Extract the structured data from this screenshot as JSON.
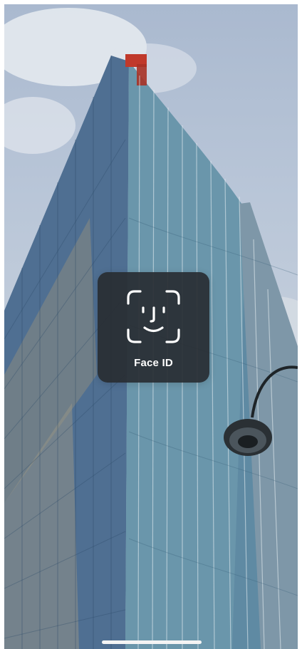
{
  "screen": {
    "type": "lock-screen",
    "wallpaper": "glass-skyscraper-photo"
  },
  "faceid_prompt": {
    "label": "Face ID",
    "icon": "face-id-icon",
    "background_color": "#2c3036",
    "text_color": "#ffffff"
  },
  "home_indicator": {
    "color": "#f4f4f4"
  }
}
